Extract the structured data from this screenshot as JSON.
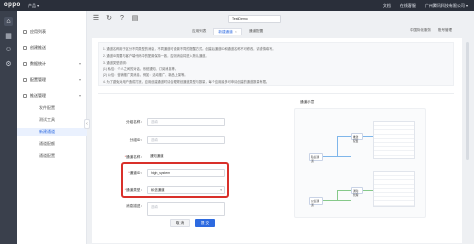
{
  "topbar": {
    "logo": "oppo",
    "product": "产品 ▾",
    "links": [
      "文档",
      "在线客服",
      "广州腾讯科技有限公司 ▾"
    ]
  },
  "rail": {
    "icons": [
      "home-icon",
      "grid-icon",
      "user-icon",
      "gear-icon"
    ]
  },
  "sidebar": {
    "items": [
      {
        "label": "应用列表",
        "level": 1
      },
      {
        "label": "创建推送",
        "level": 1
      },
      {
        "label": "数据统计",
        "level": 1,
        "caret": "▾"
      },
      {
        "label": "配置管理",
        "level": 1,
        "caret": "▾"
      },
      {
        "label": "推送管理",
        "level": 1,
        "caret": "▾"
      },
      {
        "label": "发件配置",
        "level": 2
      },
      {
        "label": "测试工具",
        "level": 2
      },
      {
        "label": "新建通道",
        "level": 2,
        "active": true
      },
      {
        "label": "通道配额",
        "level": 2
      },
      {
        "label": "通道配置",
        "level": 2
      }
    ],
    "collapse_glyph": "‹"
  },
  "toolbar": {
    "icons": [
      "list-icon",
      "refresh-icon",
      "question-icon",
      "doc-icon"
    ],
    "workspace": "TestDemo",
    "tabs": [
      {
        "label": "应用列表",
        "active": false
      },
      {
        "label": "新建通道",
        "active": true
      },
      {
        "label": "通道配置",
        "active": false
      }
    ],
    "close_glyph": "×",
    "right_links": [
      "中国际化服务",
      "账号管理"
    ]
  },
  "notice": {
    "lines": [
      "1. 通道名称用于区分不同类型的消息，不同通道可设置不同的提醒方式。创建后通道ID和通道名称不可修改，请谨慎填写。",
      "2. 通道ID需要与客户端代码中的配置保持一致，否则消息将进入默认通道。",
      "3. 通道类型说明：",
      "(1) 私信：个人之间的对话，系统通知、订阅消息等。",
      "(2) 公信：营销推广类消息，例如：活动推广、新品上架等。",
      "4. 为了避免对用户造成打扰，应用创建通道时请合理规划通道类型与数量，每个应用最多可申请创建的通道数量有限。"
    ]
  },
  "form": {
    "fields": [
      {
        "label": "分组名称：",
        "value": "选填",
        "placeholder": true,
        "required": false
      },
      {
        "label": "分组ID：",
        "value": "选填",
        "placeholder": true,
        "required": false
      },
      {
        "label": "通道名称：",
        "value": "通知通道",
        "placeholder": false,
        "required": true
      },
      {
        "label": "通道ID：",
        "value": "high_system",
        "placeholder": false,
        "required": true
      },
      {
        "label": "通道类型：",
        "value": "私信通道",
        "placeholder": false,
        "required": true
      },
      {
        "label": "消息描述：",
        "value": "选填",
        "placeholder": true,
        "required": false
      }
    ],
    "required_mark": "*",
    "select_caret": "▾",
    "cancel_label": "取 消",
    "submit_label": "提 交"
  },
  "preview": {
    "title": "通道示意",
    "node_labels": [
      "私信通道",
      "公信通道",
      "推送配置",
      "通知管理"
    ]
  }
}
